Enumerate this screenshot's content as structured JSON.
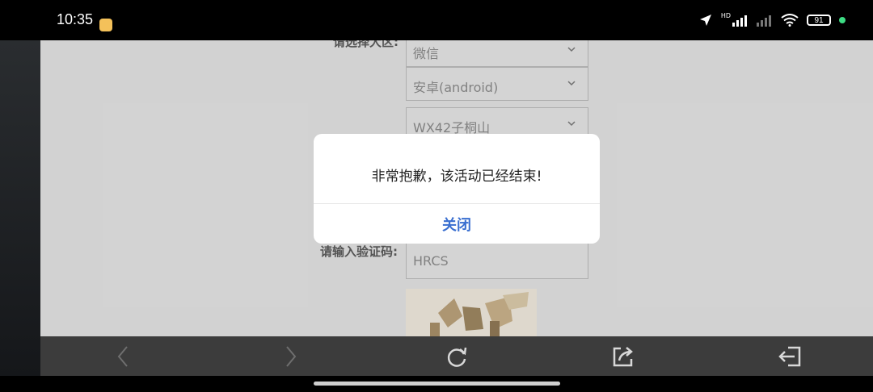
{
  "status_bar": {
    "time": "10:35",
    "battery": "91",
    "network_label": "HD"
  },
  "form": {
    "label_top_partial": "请选择大区:",
    "selects": [
      {
        "value": "微信"
      },
      {
        "value": "安卓(android)"
      },
      {
        "value": "WX42子桐山"
      }
    ],
    "captcha_label": "请输入验证码:",
    "captcha_value": "HRCS"
  },
  "dialog": {
    "message": "非常抱歉，该活动已经结束!",
    "close_label": "关闭"
  },
  "colors": {
    "accent": "#3a6fd0",
    "page_bg": "#e0e0e0",
    "toolbar_bg": "#3c3c3c"
  },
  "toolbar_icons": [
    "back-icon",
    "forward-icon",
    "refresh-icon",
    "share-icon",
    "exit-icon"
  ]
}
